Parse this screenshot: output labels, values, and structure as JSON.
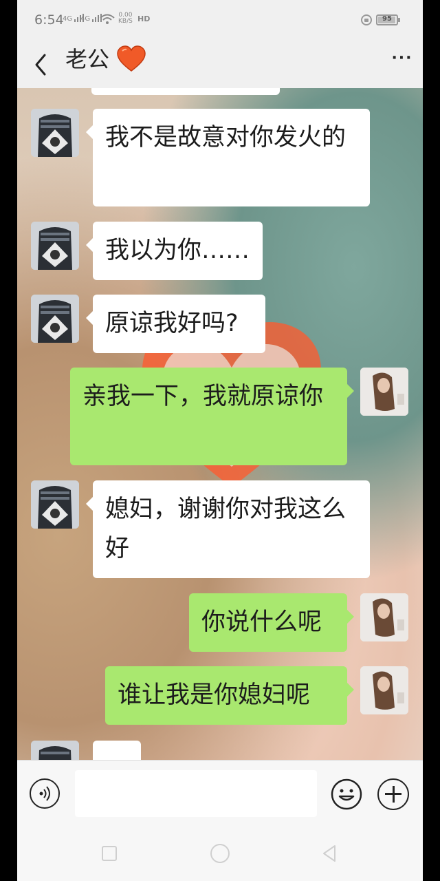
{
  "status_bar": {
    "time": "6:54",
    "signal1": "4G",
    "signal2": "4G",
    "net_speed": "0.00",
    "net_unit": "KB/S",
    "hd": "HD",
    "battery": "95",
    "battery_level": 0.95
  },
  "header": {
    "contact_name": "老公",
    "heart": "❤️",
    "more": "···"
  },
  "messages": [
    {
      "sender": "contact",
      "text": "我不是故意对你发火的"
    },
    {
      "sender": "contact",
      "text": "我以为你……"
    },
    {
      "sender": "contact",
      "text": "原谅我好吗?"
    },
    {
      "sender": "me",
      "text": "亲我一下，我就原谅你"
    },
    {
      "sender": "contact",
      "text": "媳妇，谢谢你对我这么好"
    },
    {
      "sender": "me",
      "text": "你说什么呢"
    },
    {
      "sender": "me",
      "text": "谁让我是你媳妇呢"
    }
  ],
  "colors": {
    "outgoing_bubble": "#a9e86f",
    "incoming_bubble": "#ffffff"
  },
  "icons": [
    "back-icon",
    "more-icon",
    "voice-icon",
    "emoji-icon",
    "plus-icon",
    "nav-recent-icon",
    "nav-home-icon",
    "nav-back-icon"
  ]
}
